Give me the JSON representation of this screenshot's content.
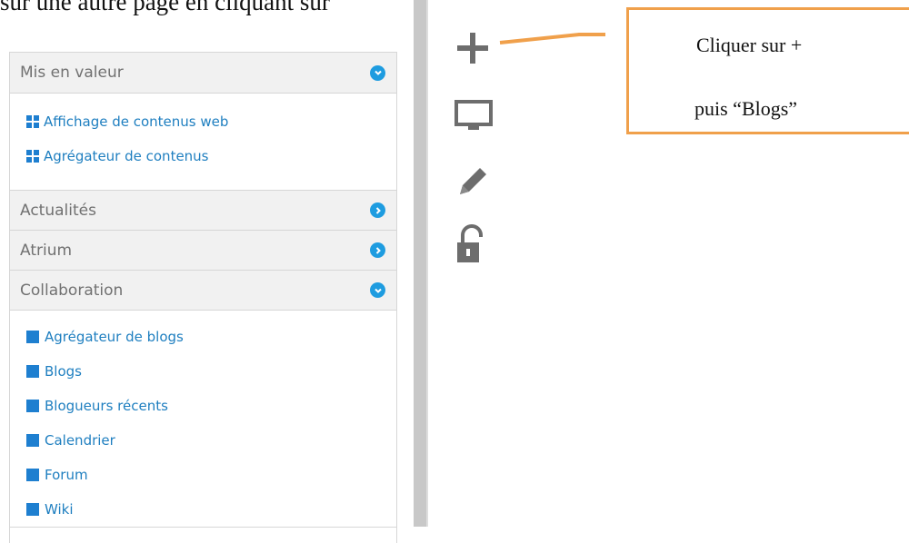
{
  "instruction_header": "sur une autre page en cliquant sur",
  "sidebar": {
    "categories": [
      {
        "label": "Mis en valeur",
        "state": "expanded",
        "items": [
          "Affichage de contenus web",
          "Agrégateur de contenus"
        ]
      },
      {
        "label": "Actualités",
        "state": "collapsed"
      },
      {
        "label": "Atrium",
        "state": "collapsed"
      },
      {
        "label": "Collaboration",
        "state": "expanded",
        "items": [
          "Agrégateur de blogs",
          "Blogs",
          "Blogueurs récents",
          "Calendrier",
          "Forum",
          "Wiki"
        ]
      }
    ]
  },
  "toolbar": {
    "icons": [
      "plus-icon",
      "monitor-icon",
      "pencil-icon",
      "unlock-icon"
    ]
  },
  "callout": {
    "line1": "Cliquer sur +",
    "line2": "puis “Blogs”"
  },
  "colors": {
    "accent": "#1e9ce0",
    "link": "#1f7fc0",
    "callout_border": "#f0a04b",
    "icon_gray": "#6d6d6d"
  }
}
